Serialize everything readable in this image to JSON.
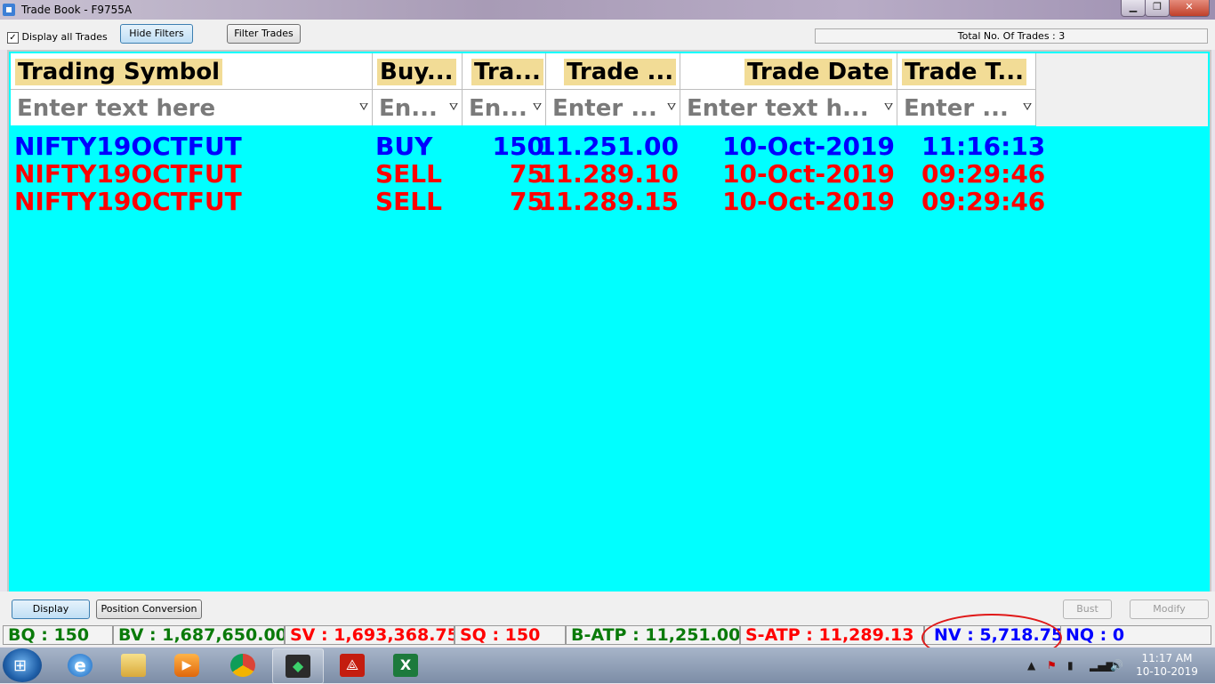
{
  "window": {
    "title": "Trade Book - F9755A"
  },
  "toolbar": {
    "display_all_label": "Display all Trades",
    "display_all_checked": "✓",
    "hide_filters_label": "Hide Filters",
    "filter_trades_label": "Filter Trades",
    "total_trades_label": "Total No. Of Trades : 3"
  },
  "grid": {
    "columns": [
      {
        "header": "Trading Symbol",
        "filter_placeholder": "Enter text here"
      },
      {
        "header": "Buy...",
        "filter_placeholder": "En..."
      },
      {
        "header": "Tra...",
        "filter_placeholder": "En..."
      },
      {
        "header": "Trade ...",
        "filter_placeholder": "Enter ..."
      },
      {
        "header": "Trade Date",
        "filter_placeholder": "Enter text h..."
      },
      {
        "header": "Trade T...",
        "filter_placeholder": "Enter ..."
      }
    ],
    "rows": [
      {
        "symbol": "NIFTY19OCTFUT",
        "side": "BUY",
        "qty": "150",
        "price": "11.251.00",
        "date": "10-Oct-2019",
        "time": "11:16:13",
        "color": "#0000ff"
      },
      {
        "symbol": "NIFTY19OCTFUT",
        "side": "SELL",
        "qty": "75",
        "price": "11.289.10",
        "date": "10-Oct-2019",
        "time": "09:29:46",
        "color": "#ff0000"
      },
      {
        "symbol": "NIFTY19OCTFUT",
        "side": "SELL",
        "qty": "75",
        "price": "11.289.15",
        "date": "10-Oct-2019",
        "time": "09:29:46",
        "color": "#ff0000"
      }
    ],
    "background": "#00ffff"
  },
  "actions": {
    "display_label": "Display",
    "position_conversion_label": "Position Conversion",
    "bust_label": "Bust",
    "modify_label": "Modify"
  },
  "stats": [
    {
      "text": "BQ : 150",
      "color": "#0a7a0a"
    },
    {
      "text": "BV : 1,687,650.00",
      "color": "#0a7a0a"
    },
    {
      "text": "SV : 1,693,368.75",
      "color": "#ff0000"
    },
    {
      "text": "SQ : 150",
      "color": "#ff0000"
    },
    {
      "text": "B-ATP : 11,251.00",
      "color": "#0a7a0a"
    },
    {
      "text": "S-ATP : 11,289.13",
      "color": "#ff0000"
    },
    {
      "text": "NV : 5,718.75",
      "color": "#0000ff"
    },
    {
      "text": "NQ : 0",
      "color": "#0000ff"
    }
  ],
  "taskbar": {
    "icons": [
      "ie-icon",
      "explorer-icon",
      "media-player-icon",
      "chrome-icon",
      "trading-app-icon",
      "acrobat-icon",
      "excel-icon"
    ],
    "clock_time": "11:17 AM",
    "clock_date": "10-10-2019"
  }
}
